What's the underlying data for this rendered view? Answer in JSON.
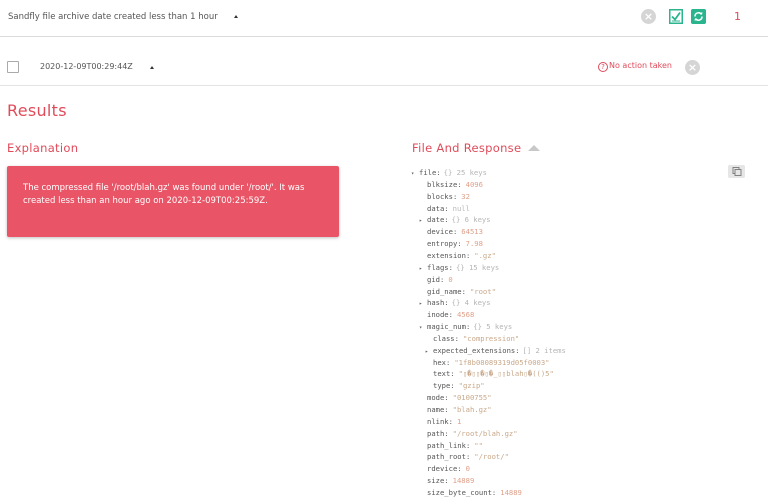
{
  "header": {
    "title": "Sandfly file archive date created less than 1 hour",
    "count": "1"
  },
  "row": {
    "timestamp": "2020-12-09T00:29:44Z",
    "status": "No action taken"
  },
  "results": {
    "heading": "Results",
    "explanation_heading": "Explanation",
    "explanation_text": "The compressed file '/root/blah.gz' was found under '/root/'. It was created less than an hour ago on 2020-12-09T00:25:59Z.",
    "far_heading": "File And Response"
  },
  "tree": [
    {
      "key": "file:",
      "meta": "{} 25 keys",
      "toggle": "▾",
      "indent": 0
    },
    {
      "key": "blksize:",
      "value": "4096",
      "type": "num",
      "indent": 1
    },
    {
      "key": "blocks:",
      "value": "32",
      "type": "num",
      "indent": 1
    },
    {
      "key": "data:",
      "value": "null",
      "type": "null",
      "indent": 1
    },
    {
      "key": "date:",
      "meta": "{} 6 keys",
      "toggle": "▸",
      "indent": 1
    },
    {
      "key": "device:",
      "value": "64513",
      "type": "num",
      "indent": 1
    },
    {
      "key": "entropy:",
      "value": "7.98",
      "type": "num",
      "indent": 1
    },
    {
      "key": "extension:",
      "value": "\".gz\"",
      "type": "str",
      "indent": 1
    },
    {
      "key": "flags:",
      "meta": "{} 15 keys",
      "toggle": "▸",
      "indent": 1
    },
    {
      "key": "gid:",
      "value": "0",
      "type": "num",
      "indent": 1
    },
    {
      "key": "gid_name:",
      "value": "\"root\"",
      "type": "str",
      "indent": 1
    },
    {
      "key": "hash:",
      "meta": "{} 4 keys",
      "toggle": "▸",
      "indent": 1
    },
    {
      "key": "inode:",
      "value": "4568",
      "type": "num",
      "indent": 1
    },
    {
      "key": "magic_num:",
      "meta": "{} 5 keys",
      "toggle": "▾",
      "indent": 1
    },
    {
      "key": "class:",
      "value": "\"compression\"",
      "type": "str",
      "indent": 2
    },
    {
      "key": "expected_extensions:",
      "meta": "[] 2 items",
      "toggle": "▸",
      "indent": 2
    },
    {
      "key": "hex:",
      "value": "\"1f8b08089319d05f0003\"",
      "type": "str",
      "indent": 2
    },
    {
      "key": "text:",
      "value": "\"▯�▯▯�▯�_▯▯blah▯�(()5\"",
      "type": "str",
      "indent": 2
    },
    {
      "key": "type:",
      "value": "\"gzip\"",
      "type": "str",
      "indent": 2
    },
    {
      "key": "mode:",
      "value": "\"0100755\"",
      "type": "str",
      "indent": 1
    },
    {
      "key": "name:",
      "value": "\"blah.gz\"",
      "type": "str",
      "indent": 1
    },
    {
      "key": "nlink:",
      "value": "1",
      "type": "num",
      "indent": 1
    },
    {
      "key": "path:",
      "value": "\"/root/blah.gz\"",
      "type": "str",
      "indent": 1
    },
    {
      "key": "path_link:",
      "value": "\"\"",
      "type": "str",
      "indent": 1
    },
    {
      "key": "path_root:",
      "value": "\"/root/\"",
      "type": "str",
      "indent": 1
    },
    {
      "key": "rdevice:",
      "value": "0",
      "type": "num",
      "indent": 1
    },
    {
      "key": "size:",
      "value": "14889",
      "type": "num",
      "indent": 1
    },
    {
      "key": "size_byte_count:",
      "value": "14889",
      "type": "num",
      "indent": 1
    }
  ],
  "colors": {
    "accent": "#e04b5a",
    "card": "#e95567",
    "sync": "#2bb58f"
  },
  "icons": [
    "close-circle-icon",
    "checklist-icon",
    "sync-icon",
    "question-circle-icon",
    "copy-icon",
    "caret-up-icon"
  ]
}
